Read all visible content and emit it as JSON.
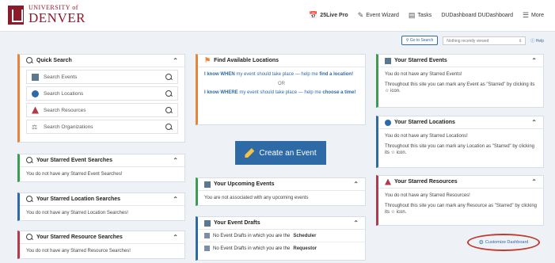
{
  "header": {
    "logo_line1": "UNIVERSITY of",
    "logo_line2": "DENVER",
    "nav": [
      {
        "label": "25Live Pro",
        "icon": "calendar-icon"
      },
      {
        "label": "Event Wizard",
        "icon": "edit-icon"
      },
      {
        "label": "Tasks",
        "icon": "tasks-icon"
      },
      {
        "label": "DUDashboard DUDashboard"
      },
      {
        "label": "More",
        "icon": "menu-icon"
      }
    ]
  },
  "subbar": {
    "goto_label": "Go to Search",
    "recent_value": "Nothing recently viewed",
    "help_label": "Help"
  },
  "quick_search": {
    "title": "Quick Search",
    "rows": [
      {
        "label": "Search Events",
        "icon": "event-icon"
      },
      {
        "label": "Search Locations",
        "icon": "location-icon"
      },
      {
        "label": "Search Resources",
        "icon": "resource-icon"
      },
      {
        "label": "Search Organizations",
        "icon": "organization-icon"
      }
    ]
  },
  "starred_event_searches": {
    "title": "Your Starred Event Searches",
    "body": "You do not have any Starred Event Searches!"
  },
  "starred_location_searches": {
    "title": "Your Starred Location Searches",
    "body": "You do not have any Starred Location Searches!"
  },
  "starred_resource_searches": {
    "title": "Your Starred Resource Searches",
    "body": "You do not have any Starred Resource Searches!"
  },
  "find_locations": {
    "title": "Find Available Locations",
    "when_prefix": "I know",
    "when_bold": "WHEN",
    "when_mid": "my event should take place — help me",
    "when_link": "find a location!",
    "or": "OR",
    "where_prefix": "I know",
    "where_bold": "WHERE",
    "where_mid": "my event should take place — help me",
    "where_link": "choose a time!"
  },
  "create_event": {
    "label": "Create an Event"
  },
  "upcoming": {
    "title": "Your Upcoming Events",
    "body": "You are not associated with any upcoming events"
  },
  "drafts": {
    "title": "Your Event Drafts",
    "row1_text": "No Event Drafts in which you are the",
    "row1_bold": "Scheduler",
    "row2_text": "No Event Drafts in which you are the",
    "row2_bold": "Requestor"
  },
  "starred_events": {
    "title": "Your Starred Events",
    "body1": "You do not have any Starred Events!",
    "body2": "Throughout this site you can mark any Event as \"Starred\" by clicking its ☆ icon."
  },
  "starred_locations": {
    "title": "Your Starred Locations",
    "body1": "You do not have any Starred Locations!",
    "body2": "Throughout this site you can mark any Location as \"Starred\" by clicking its ☆ icon."
  },
  "starred_resources": {
    "title": "Your Starred Resources",
    "body1": "You do not have any Starred Resources!",
    "body2": "Throughout this site you can mark any Resource as \"Starred\" by clicking its ☆ icon."
  },
  "customize": {
    "label": "Customize Dashboard"
  },
  "colors": {
    "brand": "#8b1a2b",
    "link": "#2d6aa6",
    "green": "#3e9b52",
    "red": "#b33a4a"
  }
}
